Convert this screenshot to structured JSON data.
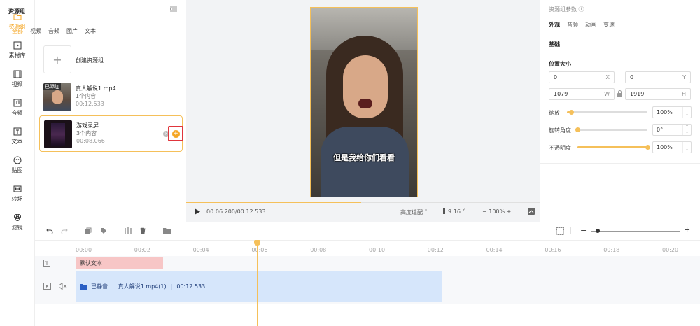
{
  "nav": [
    {
      "label": "资源组",
      "icon": "folder-icon",
      "active": true
    },
    {
      "label": "素材库",
      "icon": "play-square-icon"
    },
    {
      "label": "视频",
      "icon": "film-icon"
    },
    {
      "label": "音频",
      "icon": "music-icon"
    },
    {
      "label": "文本",
      "icon": "text-icon"
    },
    {
      "label": "贴图",
      "icon": "sticker-icon"
    },
    {
      "label": "转场",
      "icon": "transition-icon"
    },
    {
      "label": "滤镜",
      "icon": "filter-icon"
    }
  ],
  "panel": {
    "title": "资源组",
    "tabs": [
      "全部",
      "视频",
      "音频",
      "图片",
      "文本"
    ],
    "create_label": "创建资源组",
    "items": [
      {
        "tag": "已添加",
        "name": "真人解说1.mp4",
        "count": "1个内容",
        "duration": "00:12.533"
      },
      {
        "name": "游戏录屏",
        "count": "3个内容",
        "duration": "00:08.066"
      }
    ]
  },
  "preview": {
    "subtitle": "但是我给你们看看",
    "time": "00:06.200/00:12.533",
    "fit": "高度适配 ˅",
    "aspect": "9:16 ˅",
    "zoom": "− 100% +",
    "progress": 0.495
  },
  "props": {
    "title": "资源组参数 ⓘ",
    "tabs": [
      "外观",
      "音频",
      "动画",
      "变速"
    ],
    "basic": "基础",
    "pos_size": "位置大小",
    "x": "0",
    "x_unit": "X",
    "y": "0",
    "y_unit": "Y",
    "w": "1079",
    "w_unit": "W",
    "h": "1919",
    "h_unit": "H",
    "scale_label": "缩放",
    "scale_val": "100%",
    "scale_level": 0.05,
    "rot_label": "旋转角度",
    "rot_val": "0°",
    "rot_level": 0.0,
    "opacity_label": "不透明度",
    "opacity_val": "100%",
    "opacity_level": 1.0
  },
  "timeline": {
    "ticks": [
      "00:00",
      "00:02",
      "00:04",
      "00:06",
      "00:08",
      "00:10",
      "00:12",
      "00:14",
      "00:16",
      "00:18",
      "00:20"
    ],
    "text_clip": "默认文本",
    "video_muted": "已静音",
    "video_name": "真人解说1.mp4(1)",
    "video_dur": "00:12.533"
  }
}
